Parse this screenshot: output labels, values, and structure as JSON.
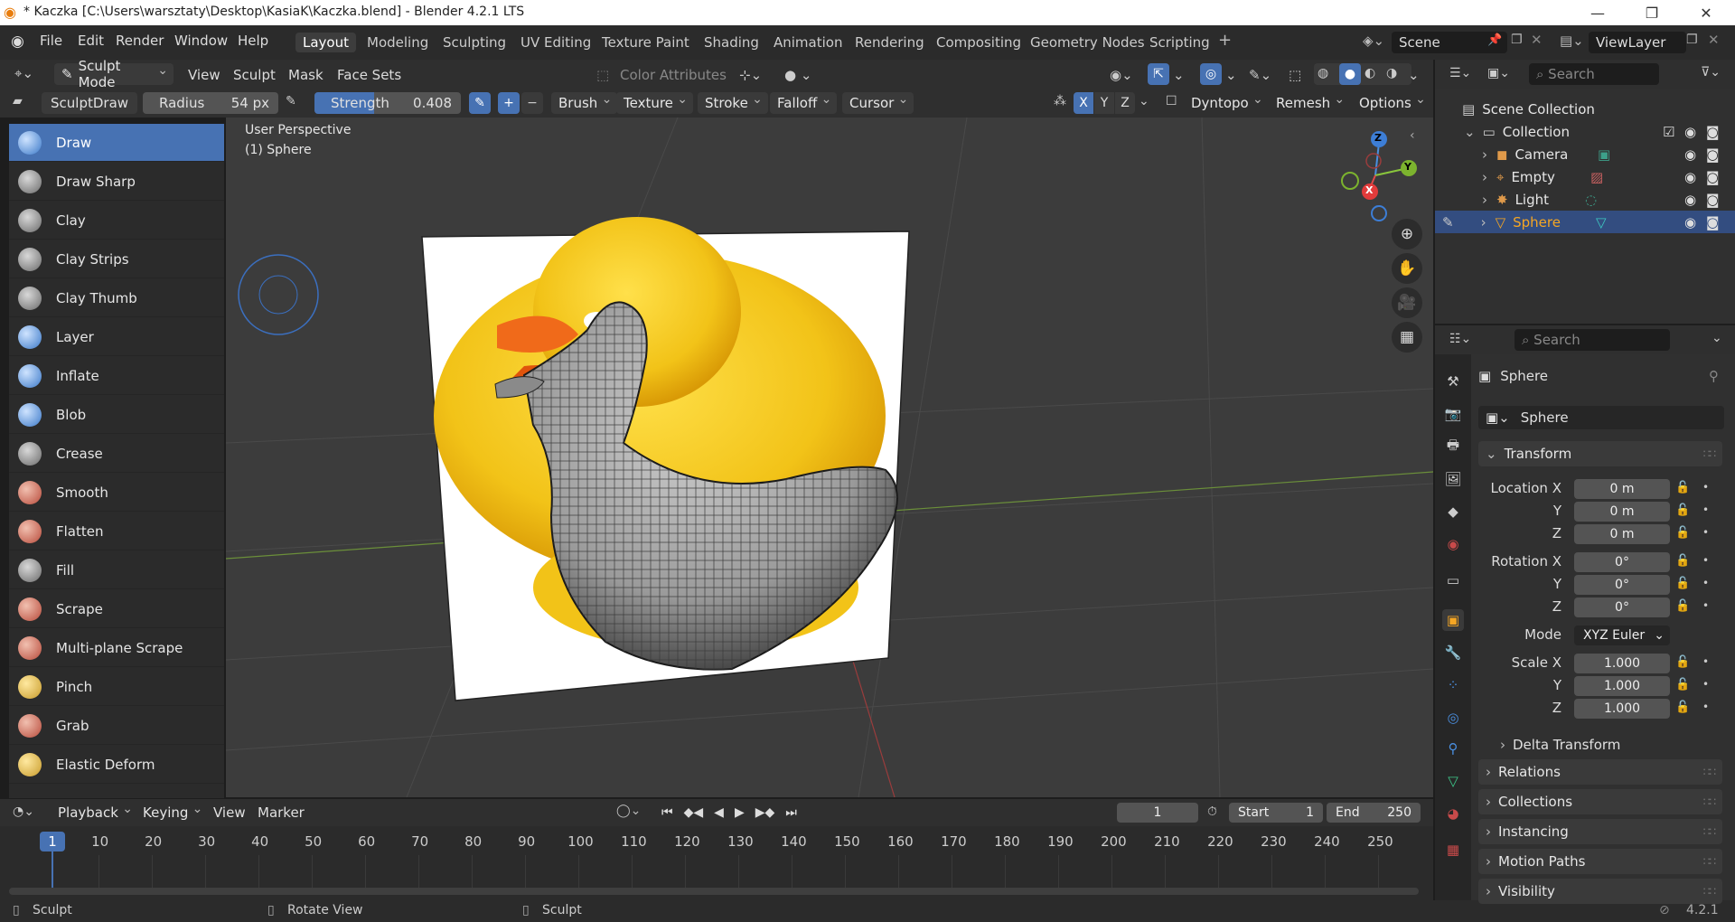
{
  "titlebar": {
    "title": "* Kaczka [C:\\Users\\warsztaty\\Desktop\\KasiaK\\Kaczka.blend] - Blender 4.2.1 LTS"
  },
  "menu": [
    "File",
    "Edit",
    "Render",
    "Window",
    "Help"
  ],
  "workspaces": [
    "Layout",
    "Modeling",
    "Sculpting",
    "UV Editing",
    "Texture Paint",
    "Shading",
    "Animation",
    "Rendering",
    "Compositing",
    "Geometry Nodes",
    "Scripting"
  ],
  "scene": {
    "name": "Scene",
    "viewlayer": "ViewLayer"
  },
  "header": {
    "mode": "Sculpt Mode",
    "view": "View",
    "sculpt": "Sculpt",
    "mask": "Mask",
    "face_sets": "Face Sets",
    "color_attributes": "Color Attributes"
  },
  "toolsettings": {
    "brush_name": "SculptDraw",
    "radius_label": "Radius",
    "radius_value": "54 px",
    "strength_label": "Strength",
    "strength_value": "0.408",
    "strength_fraction": 0.408,
    "brush": "Brush",
    "texture": "Texture",
    "stroke": "Stroke",
    "falloff": "Falloff",
    "cursor": "Cursor",
    "x": "X",
    "y": "Y",
    "z": "Z",
    "dyntopo": "Dyntopo",
    "remesh": "Remesh",
    "options": "Options"
  },
  "tools": [
    "Draw",
    "Draw Sharp",
    "Clay",
    "Clay Strips",
    "Clay Thumb",
    "Layer",
    "Inflate",
    "Blob",
    "Crease",
    "Smooth",
    "Flatten",
    "Fill",
    "Scrape",
    "Multi-plane Scrape",
    "Pinch",
    "Grab",
    "Elastic Deform"
  ],
  "viewport": {
    "perspective": "User Perspective",
    "object": "(1) Sphere",
    "gizmo_x": "X",
    "gizmo_y": "Y",
    "gizmo_z": "Z"
  },
  "timeline": {
    "playback": "Playback",
    "keying": "Keying",
    "view": "View",
    "marker": "Marker",
    "current_frame": "1",
    "start_label": "Start",
    "start": "1",
    "end_label": "End",
    "end": "250",
    "ticks": [
      "1",
      "10",
      "20",
      "30",
      "40",
      "50",
      "60",
      "70",
      "80",
      "90",
      "100",
      "110",
      "120",
      "130",
      "140",
      "150",
      "160",
      "170",
      "180",
      "190",
      "200",
      "210",
      "220",
      "230",
      "240",
      "250"
    ]
  },
  "status": {
    "left": "Sculpt",
    "middle": "Rotate View",
    "right": "Sculpt",
    "version": "4.2.1"
  },
  "outliner": {
    "search": "Search",
    "scene_collection": "Scene Collection",
    "collection": "Collection",
    "items": [
      "Camera",
      "Empty",
      "Light",
      "Sphere"
    ]
  },
  "properties": {
    "search": "Search",
    "object_title": "Sphere",
    "object_name": "Sphere",
    "transform": "Transform",
    "location_label": "Location X",
    "loc": [
      "0 m",
      "0 m",
      "0 m"
    ],
    "rotation_label": "Rotation X",
    "rot": [
      "0°",
      "0°",
      "0°"
    ],
    "mode_label": "Mode",
    "mode": "XYZ Euler",
    "scale_label": "Scale X",
    "scale": [
      "1.000",
      "1.000",
      "1.000"
    ],
    "y": "Y",
    "z": "Z",
    "delta": "Delta Transform",
    "panels": [
      "Relations",
      "Collections",
      "Instancing",
      "Motion Paths",
      "Visibility"
    ]
  },
  "colors": {
    "accent": "#4772b3",
    "selected_orange": "#f5a623",
    "duck_yellow": "#f2c318"
  }
}
